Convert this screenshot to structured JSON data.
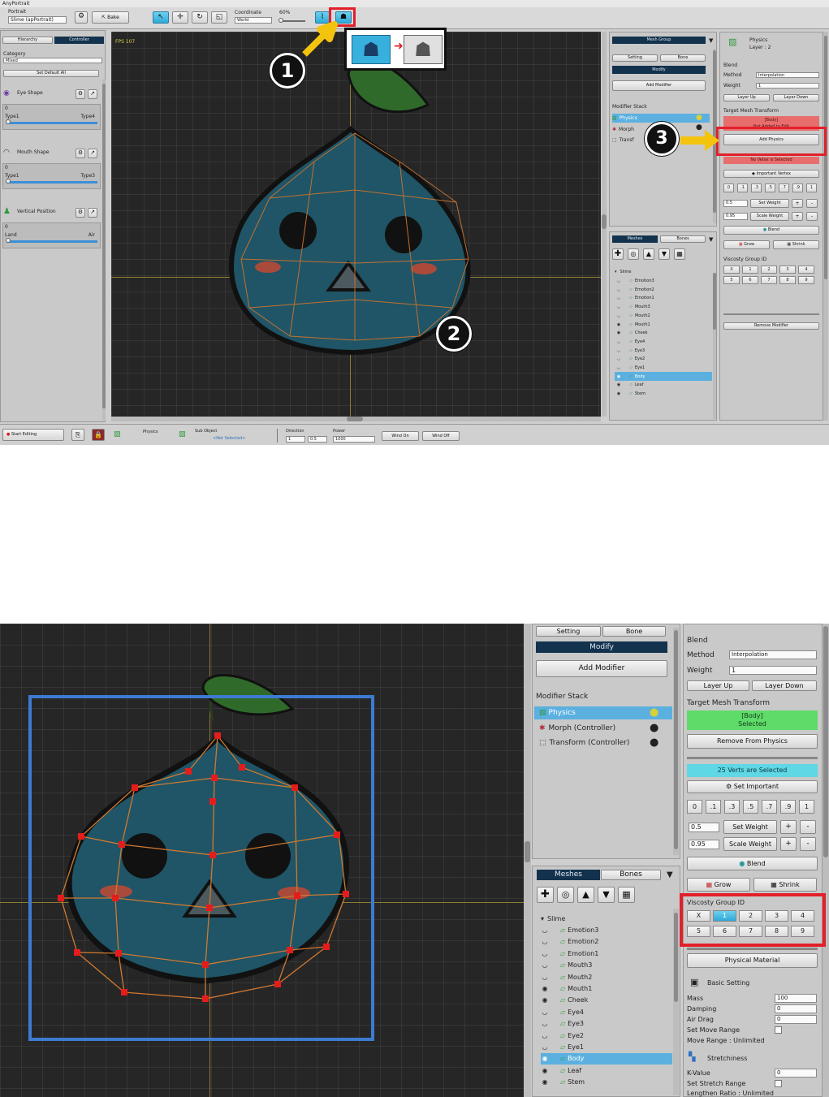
{
  "app": {
    "title": "AnyPortrait"
  },
  "toolbar": {
    "portrait_label": "Portrait",
    "portrait_value": "Slime (apPortrait)",
    "bake_label": "Bake",
    "coordinate_label": "Coordinate",
    "coordinate_value": "World",
    "zoom_value": "60%"
  },
  "left_panel": {
    "tab_hierarchy": "Hierarchy",
    "tab_controller": "Controller",
    "category_label": "Category",
    "category_value": "Mixed",
    "set_default_all": "Set Default All",
    "controllers": [
      {
        "name": "Eye Shape",
        "value": "0",
        "min_label": "Type1",
        "max_label": "Type4"
      },
      {
        "name": "Mouth Shape",
        "value": "0",
        "min_label": "Type1",
        "max_label": "Type3"
      },
      {
        "name": "Vertical Position",
        "value": "0",
        "min_label": "Land",
        "max_label": "Air"
      }
    ]
  },
  "viewport": {
    "fps": "FPS 107"
  },
  "right_panel": {
    "mesh_group_label": "Mesh Group",
    "tab_setting": "Setting",
    "tab_bone": "Bone",
    "modify_label": "Modify",
    "add_modifier": "Add Modifier",
    "modifier_stack_label": "Modifier Stack",
    "modifiers_short": [
      "Physics",
      "Morph",
      "Transf"
    ],
    "modifiers": [
      "Physics",
      "Morph (Controller)",
      "Transform (Controller)"
    ],
    "tab_meshes": "Meshes",
    "tab_bones": "Bones",
    "tree_root": "Slime",
    "tree_items": [
      "Emotion3",
      "Emotion2",
      "Emotion1",
      "Mouth3",
      "Mouth2",
      "Mouth1",
      "Cheek",
      "Eye4",
      "Eye3",
      "Eye2",
      "Eye1",
      "Body",
      "Leaf",
      "Stem"
    ]
  },
  "inspector": {
    "title": "Physics",
    "layer": "Layer : 2",
    "blend_label": "Blend",
    "method_label": "Method",
    "method_value": "Interpolation",
    "weight_label": "Weight",
    "weight_value": "1",
    "layer_up": "Layer Up",
    "layer_down": "Layer Down",
    "target_mesh_label": "Target Mesh Transform",
    "target_value_1": "[Body]",
    "target_value_1b": "Not Added to Edit",
    "target_value_2": "[Body]",
    "target_value_2b": "Selected",
    "add_physics": "Add Physics",
    "remove_from_physics": "Remove From Physics",
    "no_vertex": "No Vetex is Selected",
    "verts_selected": "25 Verts are Selected",
    "important_vertex": "Important Vertex",
    "set_important": "Set Important",
    "weights": [
      "0",
      ".1",
      ".3",
      ".5",
      ".7",
      ".9",
      "1"
    ],
    "set_weight_value": "0.5",
    "set_weight": "Set Weight",
    "scale_weight_value": "0.95",
    "scale_weight": "Scale Weight",
    "plus": "+",
    "minus": "-",
    "blend_btn": "Blend",
    "grow": "Grow",
    "shrink": "Shrink",
    "viscosity_label": "Viscosty Group ID",
    "viscosity_ids": [
      "X",
      "1",
      "2",
      "3",
      "4",
      "5",
      "6",
      "7",
      "8",
      "9"
    ],
    "remove_modifier": "Remove Modifier",
    "physical_material": "Physical Material",
    "basic_setting": "Basic Setting",
    "mass_label": "Mass",
    "mass_value": "100",
    "damping_label": "Damping",
    "damping_value": "0",
    "air_drag_label": "Air Drag",
    "air_drag_value": "0",
    "set_move_range": "Set Move Range",
    "move_range": "Move Range : Unlimited",
    "stretchiness": "Stretchiness",
    "k_value_label": "K-Value",
    "k_value": "0",
    "set_stretch_range": "Set Stretch Range",
    "lengthen_ratio": "Lengthen Ratio : Unlimited"
  },
  "bottom_bar": {
    "start_editing": "Start Editing",
    "physics_label": "Physics",
    "sub_object_label": "Sub Object",
    "sub_object_value": "<Not Selected>",
    "direction_label": "Direction",
    "direction_x": "1",
    "direction_y": "0.5",
    "power_label": "Power",
    "power_value": "1000",
    "wind_on": "Wind On",
    "wind_off": "Wind Off"
  },
  "callouts": [
    "1",
    "2",
    "3"
  ],
  "colors": {
    "accent": "#2ea9d8",
    "highlight_red": "#e2202a",
    "selected_green": "#5fdb6a",
    "selected_cyan": "#5fd7e4",
    "warning_red": "#e86d6d",
    "dark_bar": "#13324d"
  }
}
